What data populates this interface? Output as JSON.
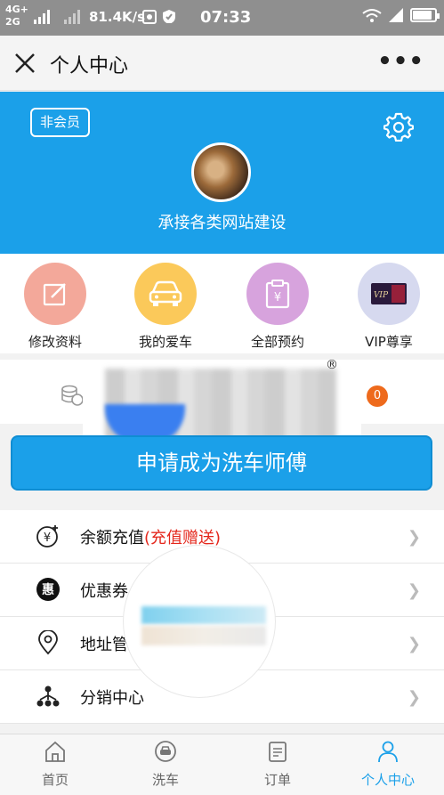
{
  "status_bar": {
    "net_top": "4G+",
    "net_bottom": "2G",
    "speed": "81.4K/s",
    "time": "07:33",
    "battery_level": 0.82,
    "background": "#8f8f8f"
  },
  "nav": {
    "title": "个人中心",
    "close_icon": "close-icon",
    "more_label": "•••"
  },
  "profile": {
    "member_badge": "非会员",
    "username": "承接各类网站建设",
    "accent": "#1ba0e9"
  },
  "quick_actions": [
    {
      "label": "修改资料",
      "icon": "edit-icon",
      "color": "#f3a89a"
    },
    {
      "label": "我的爱车",
      "icon": "car-icon",
      "color": "#fbc95a"
    },
    {
      "label": "全部预约",
      "icon": "appointment-icon",
      "color": "#d7a3dd"
    },
    {
      "label": "VIP尊享",
      "icon": "vip-card-icon",
      "color": "#d6d9ef"
    }
  ],
  "stats": {
    "registered_mark": "®",
    "badge_count": "0"
  },
  "apply_button": "申请成为洗车师傅",
  "menu": [
    {
      "label": "余额充值",
      "highlight": "(充值赠送)",
      "icon": "recharge-icon"
    },
    {
      "label": "优惠券",
      "highlight": "",
      "icon": "coupon-icon"
    },
    {
      "label": "地址管",
      "highlight": "",
      "icon": "location-icon"
    },
    {
      "label": "分销中心",
      "highlight": "",
      "icon": "distribution-icon"
    }
  ],
  "tabs": [
    {
      "label": "首页",
      "icon": "home-icon",
      "active": false
    },
    {
      "label": "洗车",
      "icon": "car-wash-icon",
      "active": false
    },
    {
      "label": "订单",
      "icon": "order-icon",
      "active": false
    },
    {
      "label": "个人中心",
      "icon": "user-icon",
      "active": true
    }
  ]
}
